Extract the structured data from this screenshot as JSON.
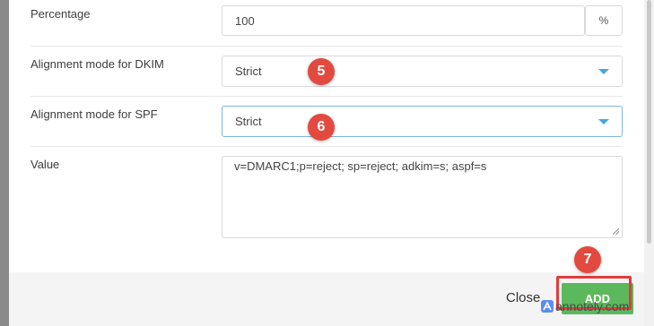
{
  "form": {
    "percentage": {
      "label": "Percentage",
      "value": "100",
      "suffix": "%"
    },
    "dkim": {
      "label": "Alignment mode for DKIM",
      "value": "Strict"
    },
    "spf": {
      "label": "Alignment mode for SPF",
      "value": "Strict"
    },
    "record": {
      "label": "Value",
      "value": "v=DMARC1;p=reject; sp=reject; adkim=s; aspf=s"
    }
  },
  "footer": {
    "close_label": "Close",
    "add_label": "ADD"
  },
  "annotations": {
    "step5": "5",
    "step6": "6",
    "step7": "7"
  },
  "watermark": {
    "text": "annotely.com"
  },
  "colors": {
    "accent": "#48a6e0",
    "add_button": "#5cb85c",
    "badge": "#e34a3f",
    "highlight": "#e03c3c"
  }
}
